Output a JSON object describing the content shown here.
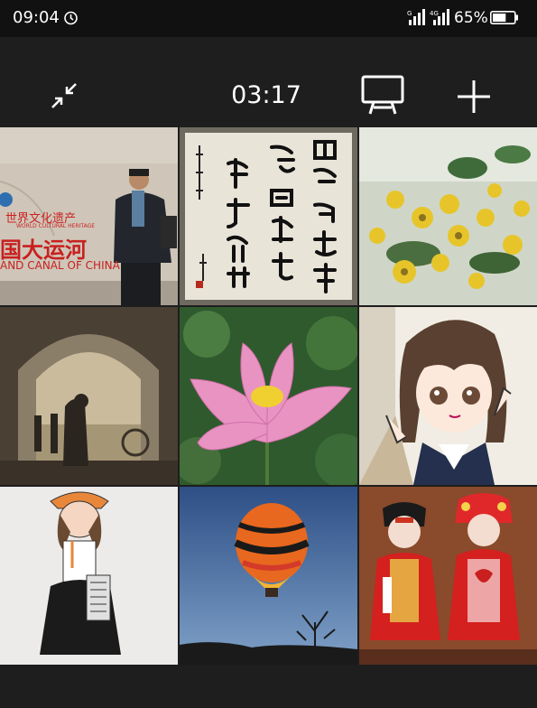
{
  "status_bar": {
    "time": "09:04",
    "battery_percent": "65%",
    "battery_level": 0.65,
    "signal_1_label": "G",
    "signal_2_label": "4G",
    "icons": [
      "alarm-clock-icon",
      "signal-icon",
      "signal-4g-icon",
      "battery-icon"
    ]
  },
  "toolbar": {
    "timer": "03:17",
    "icons": [
      "collapse-icon",
      "cast-screen-icon",
      "add-icon"
    ]
  },
  "grid": {
    "tiles": [
      {
        "subject": "man-at-grand-canal-sign",
        "sign_line1": "世界文化遗产",
        "sign_line2": "国大运河",
        "sign_line3": "AND CANAL OF CHINA",
        "sign_small": "WORLD CULTURAL HERITAGE"
      },
      {
        "subject": "chinese-calligraphy-scroll"
      },
      {
        "subject": "yellow-flowers"
      },
      {
        "subject": "couple-in-archway-painting"
      },
      {
        "subject": "pink-lotus-flower"
      },
      {
        "subject": "anime-girl-peace-sign"
      },
      {
        "subject": "girl-with-hat-illustration"
      },
      {
        "subject": "hot-air-balloon-at-dusk"
      },
      {
        "subject": "chinese-opera-dolls"
      }
    ]
  },
  "colors": {
    "background": "#1e1e1e",
    "status_bar": "#111111",
    "icon": "#ffffff"
  }
}
